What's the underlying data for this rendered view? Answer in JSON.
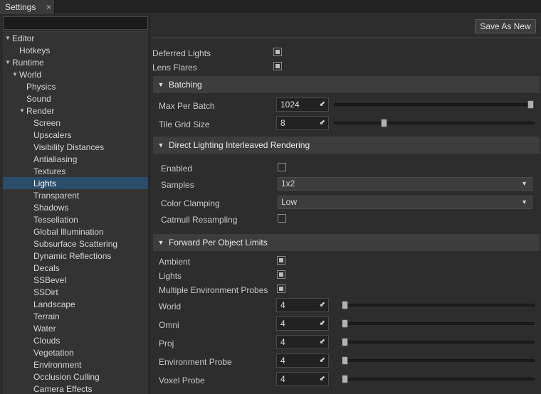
{
  "tab": {
    "title": "Settings",
    "close": "×"
  },
  "tree": [
    {
      "label": "Editor",
      "depth": 0,
      "arrow": "▼"
    },
    {
      "label": "Hotkeys",
      "depth": 1,
      "arrow": ""
    },
    {
      "label": "Runtime",
      "depth": 0,
      "arrow": "▼"
    },
    {
      "label": "World",
      "depth": 1,
      "arrow": "▼"
    },
    {
      "label": "Physics",
      "depth": 2,
      "arrow": ""
    },
    {
      "label": "Sound",
      "depth": 2,
      "arrow": ""
    },
    {
      "label": "Render",
      "depth": 2,
      "arrow": "▼"
    },
    {
      "label": "Screen",
      "depth": 3,
      "arrow": ""
    },
    {
      "label": "Upscalers",
      "depth": 3,
      "arrow": ""
    },
    {
      "label": "Visibility Distances",
      "depth": 3,
      "arrow": ""
    },
    {
      "label": "Antialiasing",
      "depth": 3,
      "arrow": ""
    },
    {
      "label": "Textures",
      "depth": 3,
      "arrow": ""
    },
    {
      "label": "Lights",
      "depth": 3,
      "arrow": "",
      "selected": true
    },
    {
      "label": "Transparent",
      "depth": 3,
      "arrow": ""
    },
    {
      "label": "Shadows",
      "depth": 3,
      "arrow": ""
    },
    {
      "label": "Tessellation",
      "depth": 3,
      "arrow": ""
    },
    {
      "label": "Global Illumination",
      "depth": 3,
      "arrow": ""
    },
    {
      "label": "Subsurface Scattering",
      "depth": 3,
      "arrow": ""
    },
    {
      "label": "Dynamic Reflections",
      "depth": 3,
      "arrow": ""
    },
    {
      "label": "Decals",
      "depth": 3,
      "arrow": ""
    },
    {
      "label": "SSBevel",
      "depth": 3,
      "arrow": ""
    },
    {
      "label": "SSDirt",
      "depth": 3,
      "arrow": ""
    },
    {
      "label": "Landscape",
      "depth": 3,
      "arrow": ""
    },
    {
      "label": "Terrain",
      "depth": 3,
      "arrow": ""
    },
    {
      "label": "Water",
      "depth": 3,
      "arrow": ""
    },
    {
      "label": "Clouds",
      "depth": 3,
      "arrow": ""
    },
    {
      "label": "Vegetation",
      "depth": 3,
      "arrow": ""
    },
    {
      "label": "Environment",
      "depth": 3,
      "arrow": ""
    },
    {
      "label": "Occlusion Culling",
      "depth": 3,
      "arrow": ""
    },
    {
      "label": "Camera Effects",
      "depth": 3,
      "arrow": ""
    }
  ],
  "toolbar": {
    "save_as_new": "Save As New"
  },
  "general": {
    "deferred_lights": {
      "label": "Deferred Lights",
      "checked": true
    },
    "lens_flares": {
      "label": "Lens Flares",
      "checked": true
    }
  },
  "batching": {
    "title": "Batching",
    "max_per_batch": {
      "label": "Max Per Batch",
      "value": "1024",
      "fraction": 1.0
    },
    "tile_grid_size": {
      "label": "Tile Grid Size",
      "value": "8",
      "fraction": 0.24
    }
  },
  "dlir": {
    "title": "Direct Lighting Interleaved Rendering",
    "enabled": {
      "label": "Enabled",
      "checked": false
    },
    "samples": {
      "label": "Samples",
      "value": "1x2"
    },
    "color_clamping": {
      "label": "Color Clamping",
      "value": "Low"
    },
    "catmull": {
      "label": "Catmull Resampling",
      "checked": false
    }
  },
  "fpol": {
    "title": "Forward Per Object Limits",
    "ambient": {
      "label": "Ambient",
      "checked": true
    },
    "lights": {
      "label": "Lights",
      "checked": true
    },
    "multi_env": {
      "label": "Multiple Environment Probes",
      "checked": true
    },
    "world": {
      "label": "World",
      "value": "4",
      "fraction": 0.0
    },
    "omni": {
      "label": "Omni",
      "value": "4",
      "fraction": 0.0
    },
    "proj": {
      "label": "Proj",
      "value": "4",
      "fraction": 0.0
    },
    "env_probe": {
      "label": "Environment Probe",
      "value": "4",
      "fraction": 0.0
    },
    "voxel_probe": {
      "label": "Voxel Probe",
      "value": "4",
      "fraction": 0.0
    }
  },
  "icons": {
    "collapse": "▼",
    "adjust": "⬋",
    "dropdown": "▼"
  }
}
